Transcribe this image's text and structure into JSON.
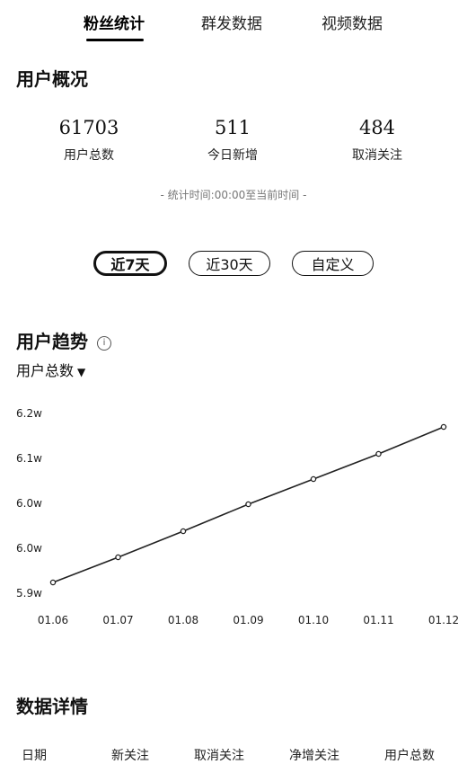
{
  "tabs": [
    {
      "label": "粉丝统计",
      "active": true
    },
    {
      "label": "群发数据",
      "active": false
    },
    {
      "label": "视频数据",
      "active": false
    }
  ],
  "overview": {
    "title": "用户概况",
    "stats": [
      {
        "value": "61703",
        "label": "用户总数"
      },
      {
        "value": "511",
        "label": "今日新增"
      },
      {
        "value": "484",
        "label": "取消关注"
      }
    ],
    "note": "- 统计时间:00:00至当前时间 -"
  },
  "ranges": [
    {
      "label": "近7天",
      "active": true
    },
    {
      "label": "近30天",
      "active": false
    },
    {
      "label": "自定义",
      "active": false
    }
  ],
  "trend": {
    "title": "用户趋势",
    "info_icon": "info-icon",
    "metric": "用户总数",
    "metric_icon": "chevron-down-icon"
  },
  "chart_data": {
    "type": "line",
    "x": [
      "01.06",
      "01.07",
      "01.08",
      "01.09",
      "01.10",
      "01.11",
      "01.12"
    ],
    "series": [
      {
        "values": [
          59570,
          59850,
          60140,
          60440,
          60720,
          61000,
          61300
        ]
      }
    ],
    "ylim": [
      59450,
      61450
    ],
    "y_ticks": [
      "6.2w",
      "6.1w",
      "6.0w",
      "6.0w",
      "5.9w"
    ],
    "grid": false,
    "line_color": "#222222"
  },
  "details": {
    "title": "数据详情",
    "columns": [
      "日期",
      "新关注",
      "取消关注",
      "净增关注",
      "用户总数"
    ]
  }
}
